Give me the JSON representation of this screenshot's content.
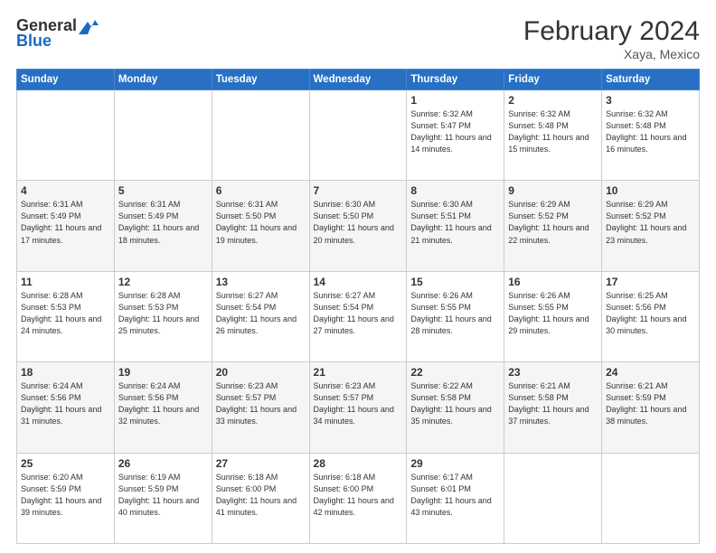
{
  "logo": {
    "general": "General",
    "blue": "Blue"
  },
  "title": "February 2024",
  "subtitle": "Xaya, Mexico",
  "days_header": [
    "Sunday",
    "Monday",
    "Tuesday",
    "Wednesday",
    "Thursday",
    "Friday",
    "Saturday"
  ],
  "weeks": [
    [
      {
        "day": "",
        "info": ""
      },
      {
        "day": "",
        "info": ""
      },
      {
        "day": "",
        "info": ""
      },
      {
        "day": "",
        "info": ""
      },
      {
        "day": "1",
        "info": "Sunrise: 6:32 AM\nSunset: 5:47 PM\nDaylight: 11 hours and 14 minutes."
      },
      {
        "day": "2",
        "info": "Sunrise: 6:32 AM\nSunset: 5:48 PM\nDaylight: 11 hours and 15 minutes."
      },
      {
        "day": "3",
        "info": "Sunrise: 6:32 AM\nSunset: 5:48 PM\nDaylight: 11 hours and 16 minutes."
      }
    ],
    [
      {
        "day": "4",
        "info": "Sunrise: 6:31 AM\nSunset: 5:49 PM\nDaylight: 11 hours and 17 minutes."
      },
      {
        "day": "5",
        "info": "Sunrise: 6:31 AM\nSunset: 5:49 PM\nDaylight: 11 hours and 18 minutes."
      },
      {
        "day": "6",
        "info": "Sunrise: 6:31 AM\nSunset: 5:50 PM\nDaylight: 11 hours and 19 minutes."
      },
      {
        "day": "7",
        "info": "Sunrise: 6:30 AM\nSunset: 5:50 PM\nDaylight: 11 hours and 20 minutes."
      },
      {
        "day": "8",
        "info": "Sunrise: 6:30 AM\nSunset: 5:51 PM\nDaylight: 11 hours and 21 minutes."
      },
      {
        "day": "9",
        "info": "Sunrise: 6:29 AM\nSunset: 5:52 PM\nDaylight: 11 hours and 22 minutes."
      },
      {
        "day": "10",
        "info": "Sunrise: 6:29 AM\nSunset: 5:52 PM\nDaylight: 11 hours and 23 minutes."
      }
    ],
    [
      {
        "day": "11",
        "info": "Sunrise: 6:28 AM\nSunset: 5:53 PM\nDaylight: 11 hours and 24 minutes."
      },
      {
        "day": "12",
        "info": "Sunrise: 6:28 AM\nSunset: 5:53 PM\nDaylight: 11 hours and 25 minutes."
      },
      {
        "day": "13",
        "info": "Sunrise: 6:27 AM\nSunset: 5:54 PM\nDaylight: 11 hours and 26 minutes."
      },
      {
        "day": "14",
        "info": "Sunrise: 6:27 AM\nSunset: 5:54 PM\nDaylight: 11 hours and 27 minutes."
      },
      {
        "day": "15",
        "info": "Sunrise: 6:26 AM\nSunset: 5:55 PM\nDaylight: 11 hours and 28 minutes."
      },
      {
        "day": "16",
        "info": "Sunrise: 6:26 AM\nSunset: 5:55 PM\nDaylight: 11 hours and 29 minutes."
      },
      {
        "day": "17",
        "info": "Sunrise: 6:25 AM\nSunset: 5:56 PM\nDaylight: 11 hours and 30 minutes."
      }
    ],
    [
      {
        "day": "18",
        "info": "Sunrise: 6:24 AM\nSunset: 5:56 PM\nDaylight: 11 hours and 31 minutes."
      },
      {
        "day": "19",
        "info": "Sunrise: 6:24 AM\nSunset: 5:56 PM\nDaylight: 11 hours and 32 minutes."
      },
      {
        "day": "20",
        "info": "Sunrise: 6:23 AM\nSunset: 5:57 PM\nDaylight: 11 hours and 33 minutes."
      },
      {
        "day": "21",
        "info": "Sunrise: 6:23 AM\nSunset: 5:57 PM\nDaylight: 11 hours and 34 minutes."
      },
      {
        "day": "22",
        "info": "Sunrise: 6:22 AM\nSunset: 5:58 PM\nDaylight: 11 hours and 35 minutes."
      },
      {
        "day": "23",
        "info": "Sunrise: 6:21 AM\nSunset: 5:58 PM\nDaylight: 11 hours and 37 minutes."
      },
      {
        "day": "24",
        "info": "Sunrise: 6:21 AM\nSunset: 5:59 PM\nDaylight: 11 hours and 38 minutes."
      }
    ],
    [
      {
        "day": "25",
        "info": "Sunrise: 6:20 AM\nSunset: 5:59 PM\nDaylight: 11 hours and 39 minutes."
      },
      {
        "day": "26",
        "info": "Sunrise: 6:19 AM\nSunset: 5:59 PM\nDaylight: 11 hours and 40 minutes."
      },
      {
        "day": "27",
        "info": "Sunrise: 6:18 AM\nSunset: 6:00 PM\nDaylight: 11 hours and 41 minutes."
      },
      {
        "day": "28",
        "info": "Sunrise: 6:18 AM\nSunset: 6:00 PM\nDaylight: 11 hours and 42 minutes."
      },
      {
        "day": "29",
        "info": "Sunrise: 6:17 AM\nSunset: 6:01 PM\nDaylight: 11 hours and 43 minutes."
      },
      {
        "day": "",
        "info": ""
      },
      {
        "day": "",
        "info": ""
      }
    ]
  ]
}
